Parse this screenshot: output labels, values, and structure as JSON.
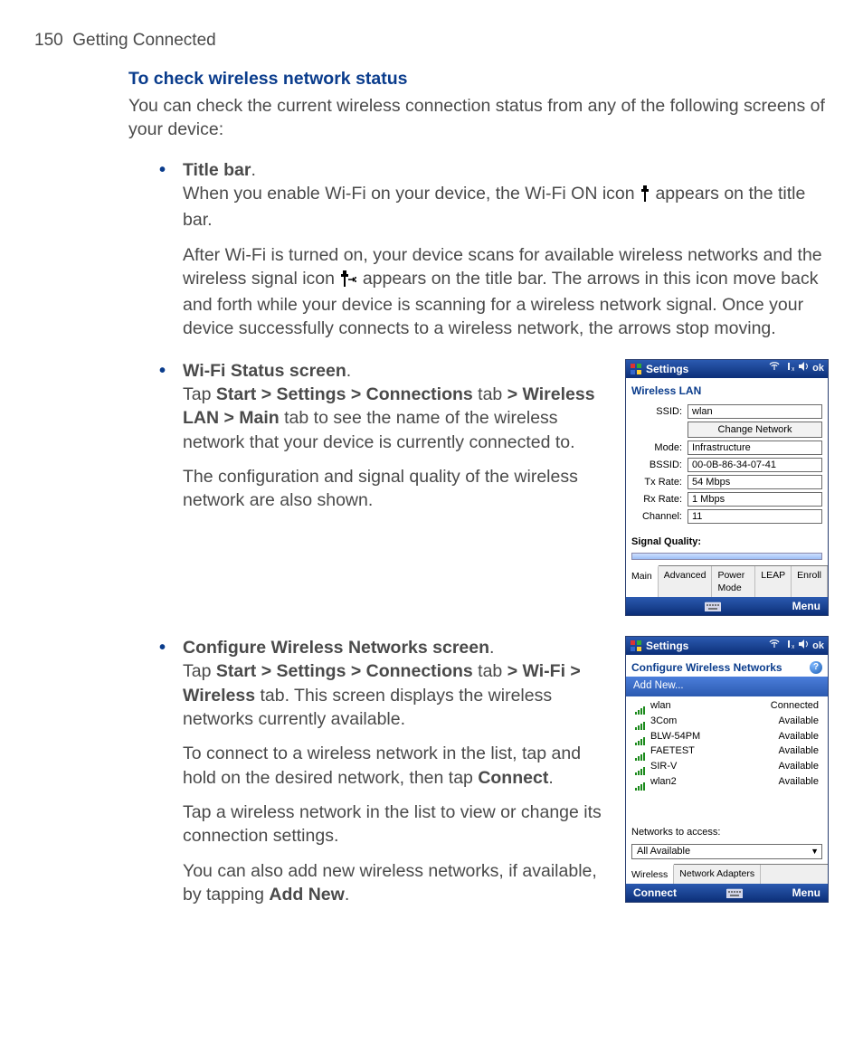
{
  "header": {
    "page_no": "150",
    "chapter": "Getting Connected"
  },
  "section_title": "To check wireless network status",
  "intro": "You can check the current wireless connection status from any of the following screens of your device:",
  "bul1": {
    "heading": "Title bar",
    "p1a": "When you enable Wi-Fi on your device, the Wi-Fi ON icon ",
    "p1b": " appears on the title bar.",
    "p2a": "After Wi-Fi is turned on, your device scans for available wireless networks and the wireless signal icon ",
    "p2b": " appears on the title bar. The arrows in this icon move back and forth while your device is scanning for a wireless network signal. Once your device successfully connects to a wireless network, the arrows stop moving."
  },
  "bul2": {
    "heading": "Wi-Fi Status screen",
    "p1a": "Tap ",
    "p1_nav1": "Start > Settings > Connections",
    "p1b": " tab ",
    "p1_nav2": "> Wireless LAN > Main",
    "p1c": " tab to see the name of the wireless network that your device is currently connected to.",
    "p2": "The configuration and signal quality of the wireless network are also shown."
  },
  "bul3": {
    "heading": "Configure Wireless Networks screen",
    "p1a": "Tap ",
    "p1_nav1": "Start > Settings > Connections",
    "p1b": " tab ",
    "p1_nav2": "> Wi-Fi > Wireless",
    "p1c": " tab. This screen displays the wireless networks currently available.",
    "p2a": "To connect to a wireless network in the list, tap and hold on the desired network, then tap ",
    "p2b": "Connect",
    "p2c": ".",
    "p3": "Tap a wireless network in the list to view or change its connection settings.",
    "p4a": "You can also add new wireless networks, if available, by tapping ",
    "p4b": "Add New",
    "p4c": "."
  },
  "dev1": {
    "title": "Settings",
    "ok": "ok",
    "panel_title": "Wireless LAN",
    "labels": {
      "ssid": "SSID:",
      "mode": "Mode:",
      "bssid": "BSSID:",
      "txrate": "Tx Rate:",
      "rxrate": "Rx Rate:",
      "channel": "Channel:"
    },
    "values": {
      "ssid": "wlan",
      "mode": "Infrastructure",
      "bssid": "00-0B-86-34-07-41",
      "txrate": "54 Mbps",
      "rxrate": "1 Mbps",
      "channel": "11"
    },
    "change_btn": "Change Network",
    "signal_quality": "Signal Quality:",
    "tabs": [
      "Main",
      "Advanced",
      "Power Mode",
      "LEAP",
      "Enroll"
    ],
    "menu": "Menu"
  },
  "dev2": {
    "title": "Settings",
    "ok": "ok",
    "panel_title": "Configure Wireless Networks",
    "add_new": "Add New...",
    "networks": [
      {
        "name": "wlan",
        "status": "Connected"
      },
      {
        "name": "3Com",
        "status": "Available"
      },
      {
        "name": "BLW-54PM",
        "status": "Available"
      },
      {
        "name": "FAETEST",
        "status": "Available"
      },
      {
        "name": "SIR-V",
        "status": "Available"
      },
      {
        "name": "wlan2",
        "status": "Available"
      }
    ],
    "filter_label": "Networks to access:",
    "filter_value": "All Available",
    "tabs": [
      "Wireless",
      "Network Adapters"
    ],
    "connect": "Connect",
    "menu": "Menu"
  }
}
